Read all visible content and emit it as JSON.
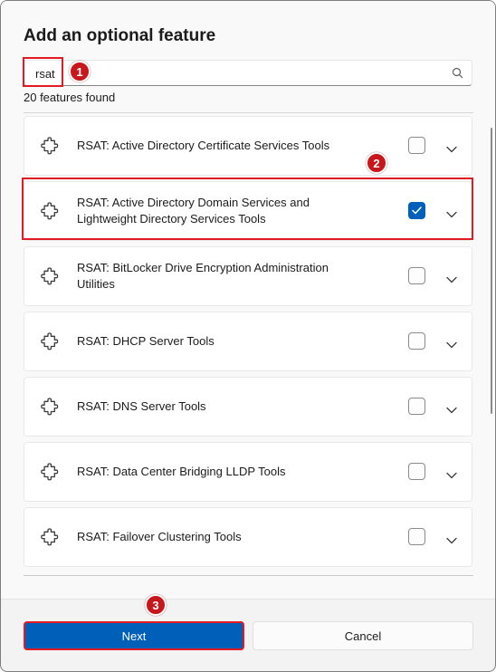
{
  "dialog": {
    "title": "Add an optional feature",
    "search": {
      "value": "rsat",
      "placeholder": ""
    },
    "results_count": "20 features found",
    "next_label": "Next",
    "cancel_label": "Cancel"
  },
  "features": [
    {
      "name": "RSAT: Active Directory Certificate Services Tools",
      "checked": false
    },
    {
      "name": "RSAT: Active Directory Domain Services and Lightweight Directory Services Tools",
      "checked": true
    },
    {
      "name": "RSAT: BitLocker Drive Encryption Administration Utilities",
      "checked": false
    },
    {
      "name": "RSAT: DHCP Server Tools",
      "checked": false
    },
    {
      "name": "RSAT: DNS Server Tools",
      "checked": false
    },
    {
      "name": "RSAT: Data Center Bridging LLDP Tools",
      "checked": false
    },
    {
      "name": "RSAT: Failover Clustering Tools",
      "checked": false
    }
  ],
  "annotations": {
    "step1": "1",
    "step2": "2",
    "step3": "3"
  },
  "colors": {
    "accent": "#005fb8",
    "annotation": "#e01b24",
    "badge": "#c8161d"
  },
  "icons": {
    "feature": "puzzle-icon",
    "search": "search-icon",
    "expand": "chevron-down-icon",
    "check": "checkmark-icon"
  }
}
